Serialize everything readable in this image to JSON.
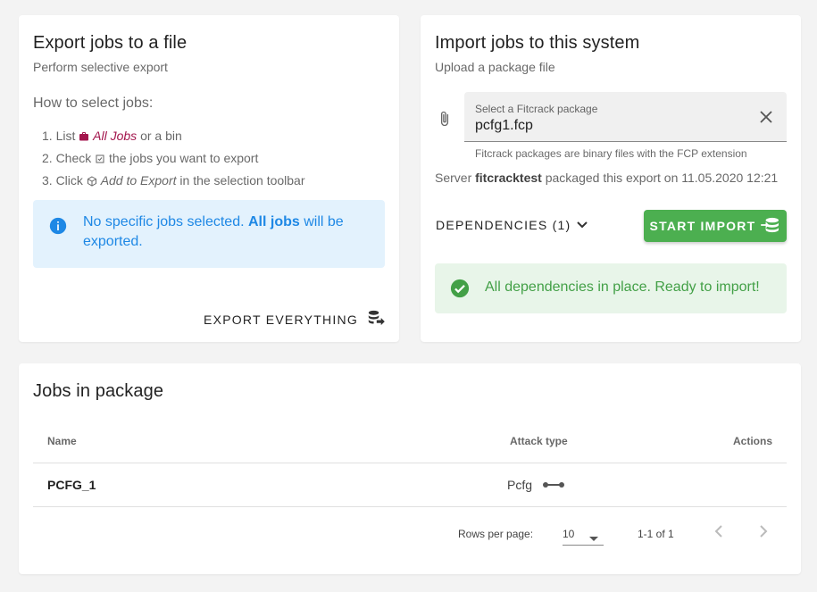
{
  "export_card": {
    "title": "Export jobs to a file",
    "subtitle": "Perform selective export",
    "how_title": "How to select jobs:",
    "step1_prefix": "1. List",
    "step1_link": "All Jobs",
    "step1_suffix": "or a bin",
    "step2_prefix": "2. Check",
    "step2_suffix": "the jobs you want to export",
    "step3_prefix": "3. Click",
    "step3_em": "Add to Export",
    "step3_suffix": "in the selection toolbar",
    "alert_text_a": "No specific jobs selected.",
    "alert_text_b": "All jobs",
    "alert_text_c": "will be exported.",
    "export_button": "Export everything"
  },
  "import_card": {
    "title": "Import jobs to this system",
    "subtitle": "Upload a package file",
    "file_label": "Select a Fitcrack package",
    "file_value": "pcfg1.fcp",
    "file_hint": "Fitcrack packages are binary files with the FCP extension",
    "server_prefix": "Server",
    "server_name": "fitcracktest",
    "server_suffix": "packaged this export on 11.05.2020 12:21",
    "deps_button": "Dependencies (1)",
    "start_button": "Start Import",
    "success_text": "All dependencies in place. Ready to import!"
  },
  "jobs_card": {
    "title": "Jobs in package",
    "columns": {
      "name": "Name",
      "attack": "Attack type",
      "actions": "Actions"
    },
    "rows": [
      {
        "name": "PCFG_1",
        "attack": "Pcfg"
      }
    ],
    "rows_per_page_label": "Rows per page:",
    "rows_per_page_value": "10",
    "page_info": "1-1 of 1"
  },
  "colors": {
    "accent_pink": "#a3154c",
    "info_blue": "#1e88e5",
    "success_green": "#4caf50"
  },
  "icons": [
    "briefcase-icon",
    "checkbox-icon",
    "package-icon",
    "info-icon",
    "export-icon",
    "paperclip-icon",
    "close-icon",
    "chevron-down-icon",
    "import-icon",
    "check-circle-icon",
    "pcfg-icon",
    "caret-down-icon",
    "chevron-left-icon",
    "chevron-right-icon"
  ]
}
